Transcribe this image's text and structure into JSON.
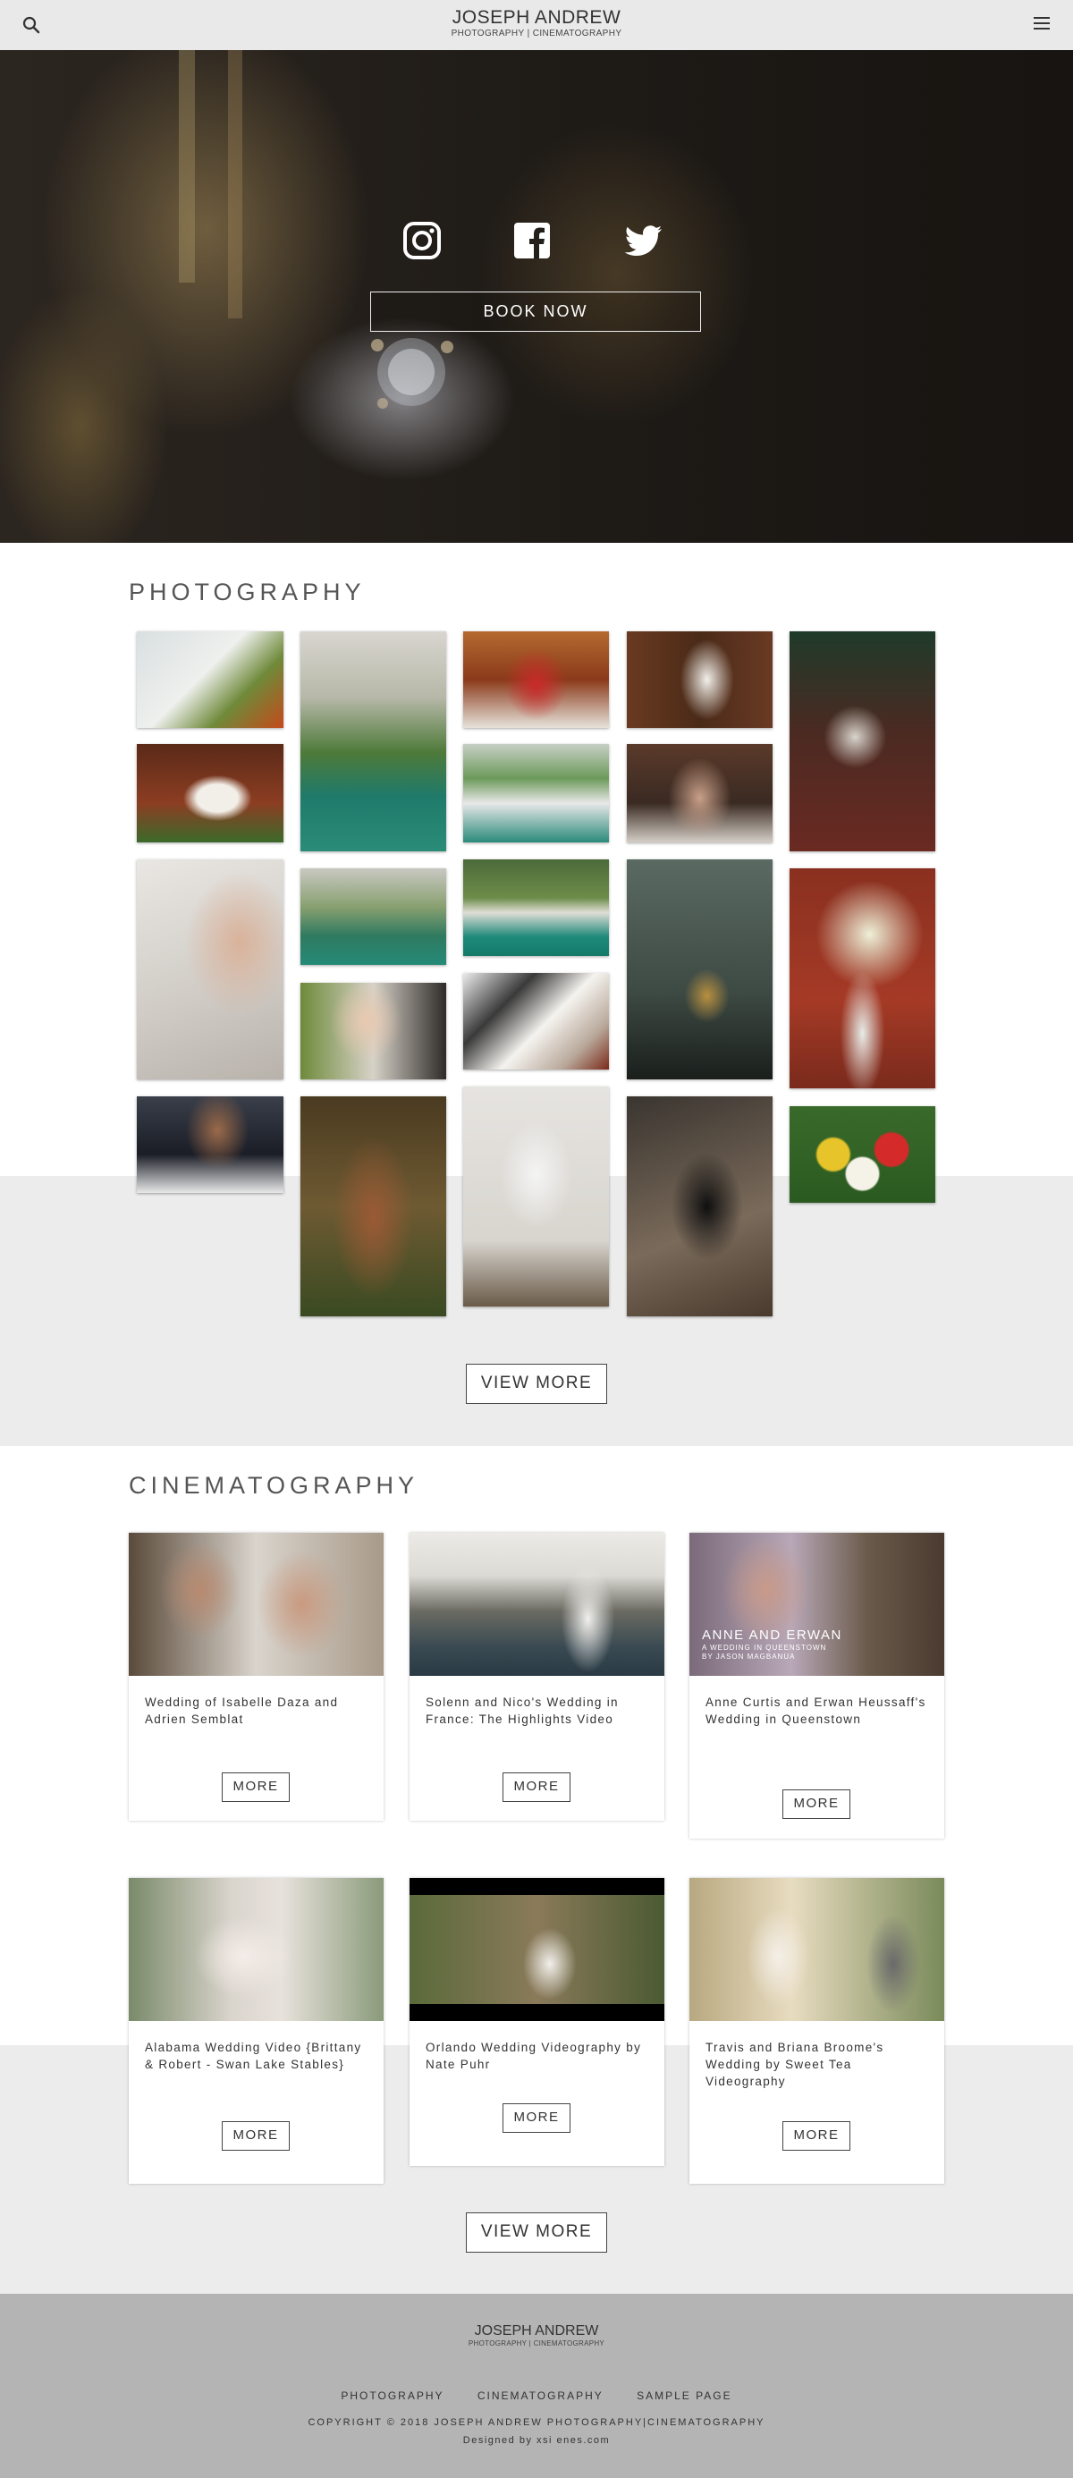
{
  "header": {
    "brand_name": "JOSEPH ANDREW",
    "brand_sub": "PHOTOGRAPHY | CINEMATOGRAPHY"
  },
  "hero": {
    "book_label": "BOOK NOW"
  },
  "photography": {
    "title": "PHOTOGRAPHY",
    "view_more_label": "VIEW MORE"
  },
  "cinematography": {
    "title": "CINEMATOGRAPHY",
    "view_more_label": "VIEW MORE",
    "videos": [
      {
        "title": "Wedding of Isabelle Daza and Adrien Semblat",
        "more": "MORE"
      },
      {
        "title": "Solenn and Nico's Wedding in France: The Highlights Video",
        "more": "MORE"
      },
      {
        "title": "Anne Curtis and Erwan Heussaff's Wedding in Queenstown",
        "more": "MORE",
        "overlay_title": "ANNE AND ERWAN",
        "overlay_sub": "A WEDDING IN QUEENSTOWN",
        "overlay_by": "BY JASON MAGBANUA"
      },
      {
        "title": "Alabama Wedding Video {Brittany & Robert - Swan Lake Stables}",
        "more": "MORE"
      },
      {
        "title": "Orlando Wedding Videography by Nate Puhr",
        "more": "MORE"
      },
      {
        "title": "Travis and Briana Broome's Wedding by Sweet Tea Videography",
        "more": "MORE"
      }
    ]
  },
  "footer": {
    "brand_name": "JOSEPH ANDREW",
    "brand_sub": "PHOTOGRAPHY | CINEMATOGRAPHY",
    "links": [
      "PHOTOGRAPHY",
      "CINEMATOGRAPHY",
      "SAMPLE PAGE"
    ],
    "copyright": "COPYRIGHT © 2018 JOSEPH ANDREW PHOTOGRAPHY|CINEMATOGRAPHY",
    "designed_by": "Designed by xsi enes.com"
  }
}
